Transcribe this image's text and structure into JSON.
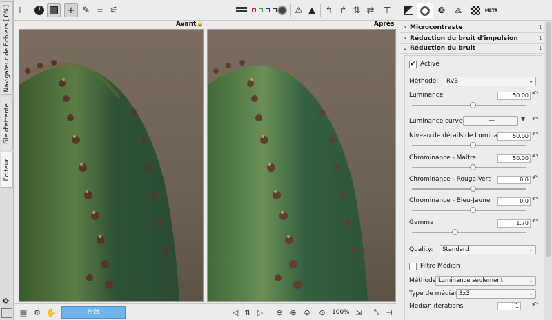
{
  "left_tabs": {
    "file_browser": "Navigateur de fichiers [ 0%]",
    "queue": "File d'attente",
    "editor": "Éditeur"
  },
  "image_labels": {
    "before": "Avant",
    "after": "Après"
  },
  "status": {
    "ready_label": "Prêt"
  },
  "zoom": {
    "level": "100%"
  },
  "tools": {
    "toolbar_icons": [
      "hand-icon",
      "info-icon",
      "before-after-icon",
      "crosshair-icon",
      "color-picker-icon",
      "crop-icon",
      "straighten-icon"
    ],
    "preview_channels": [
      "red",
      "green",
      "blue",
      "luminance",
      "focus-mask"
    ],
    "right_icons": [
      "warning-shadow-icon",
      "warning-highlight-icon",
      "rotate-left-icon",
      "rotate-right-icon",
      "flip-horizontal-icon",
      "flip-vertical-icon",
      "expand-icon"
    ]
  },
  "right_tabs": [
    "exposure-tab-icon",
    "details-tab-icon",
    "color-tab-icon",
    "transform-tab-icon",
    "raw-tab-icon",
    "meta-tab-icon"
  ],
  "sections": {
    "microcontrast": "Microcontraste",
    "impulse_noise": "Réduction du bruit d'impulsion",
    "noise_reduction": "Réduction du bruit"
  },
  "noise": {
    "enabled_label": "Activé",
    "enabled": true,
    "method_label": "Méthode:",
    "method_value": "RVB",
    "luminance_label": "Luminance",
    "luminance_value": "50.00",
    "luminance_curve_label": "Luminance curve:",
    "luminance_curve_value": "—",
    "detail_label": "Niveau de détails de Luminance",
    "detail_value": "50.00",
    "chroma_master_label": "Chrominance - Maître",
    "chroma_master_value": "50.00",
    "chroma_rg_label": "Chrominance - Rouge-Vert",
    "chroma_rg_value": "0.0",
    "chroma_by_label": "Chrominance - Bleu-Jaune",
    "chroma_by_value": "0.0",
    "gamma_label": "Gamma",
    "gamma_value": "1.70",
    "quality_label": "Quality:",
    "quality_value": "Standard",
    "median_filter_label": "Filtre Médian",
    "median_filter_enabled": false,
    "median_method_label": "Méthode",
    "median_method_value": "Luminance seulement",
    "median_type_label": "Type de médiane",
    "median_type_value": "3x3",
    "median_iterations_label": "Median iterations",
    "median_iterations_value": "1"
  }
}
